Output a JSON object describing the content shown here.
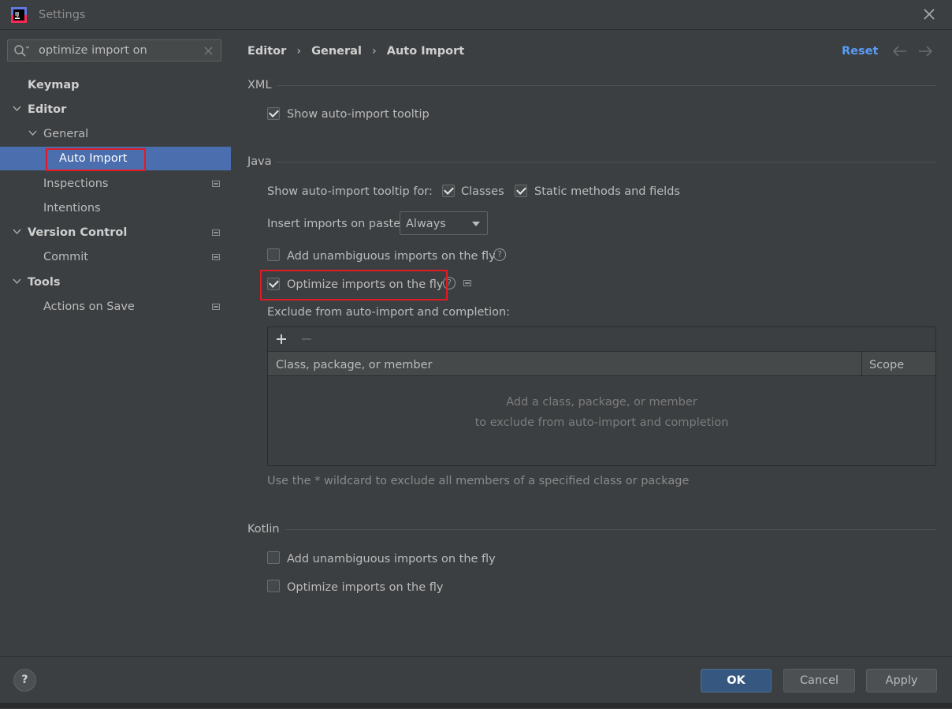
{
  "window": {
    "title": "Settings"
  },
  "sidebar": {
    "search": {
      "value": "optimize import on"
    },
    "items": [
      {
        "label": "Keymap"
      },
      {
        "label": "Editor"
      },
      {
        "label": "General"
      },
      {
        "label": "Auto Import"
      },
      {
        "label": "Inspections"
      },
      {
        "label": "Intentions"
      },
      {
        "label": "Version Control"
      },
      {
        "label": "Commit"
      },
      {
        "label": "Tools"
      },
      {
        "label": "Actions on Save"
      }
    ]
  },
  "breadcrumb": {
    "items": [
      "Editor",
      "General",
      "Auto Import"
    ],
    "separator": "›"
  },
  "header": {
    "reset_label": "Reset"
  },
  "xml": {
    "title": "XML",
    "show_tooltip": {
      "label": "Show auto-import tooltip",
      "checked": true
    }
  },
  "java": {
    "title": "Java",
    "tooltip_for_label": "Show auto-import tooltip for:",
    "classes": {
      "label": "Classes",
      "checked": true
    },
    "static_methods": {
      "label": "Static methods and fields",
      "checked": true
    },
    "insert_imports_label": "Insert imports on paste:",
    "insert_imports_value": "Always",
    "add_unambiguous": {
      "label": "Add unambiguous imports on the fly",
      "checked": false
    },
    "optimize_imports": {
      "label": "Optimize imports on the fly",
      "checked": true
    },
    "exclude_label": "Exclude from auto-import and completion:",
    "table": {
      "columns": [
        "Class, package, or member",
        "Scope"
      ],
      "empty_line1": "Add a class, package, or member",
      "empty_line2": "to exclude from auto-import and completion"
    },
    "wildcard_hint": "Use the * wildcard to exclude all members of a specified class or package"
  },
  "kotlin": {
    "title": "Kotlin",
    "add_unambiguous": {
      "label": "Add unambiguous imports on the fly",
      "checked": false
    },
    "optimize_imports": {
      "label": "Optimize imports on the fly",
      "checked": false
    }
  },
  "footer": {
    "help": "?",
    "ok": "OK",
    "cancel": "Cancel",
    "apply": "Apply"
  },
  "colors": {
    "accent": "#4b6eaf",
    "link": "#589df6",
    "highlight_box": "#e01b24",
    "ok_button": "#365880"
  }
}
